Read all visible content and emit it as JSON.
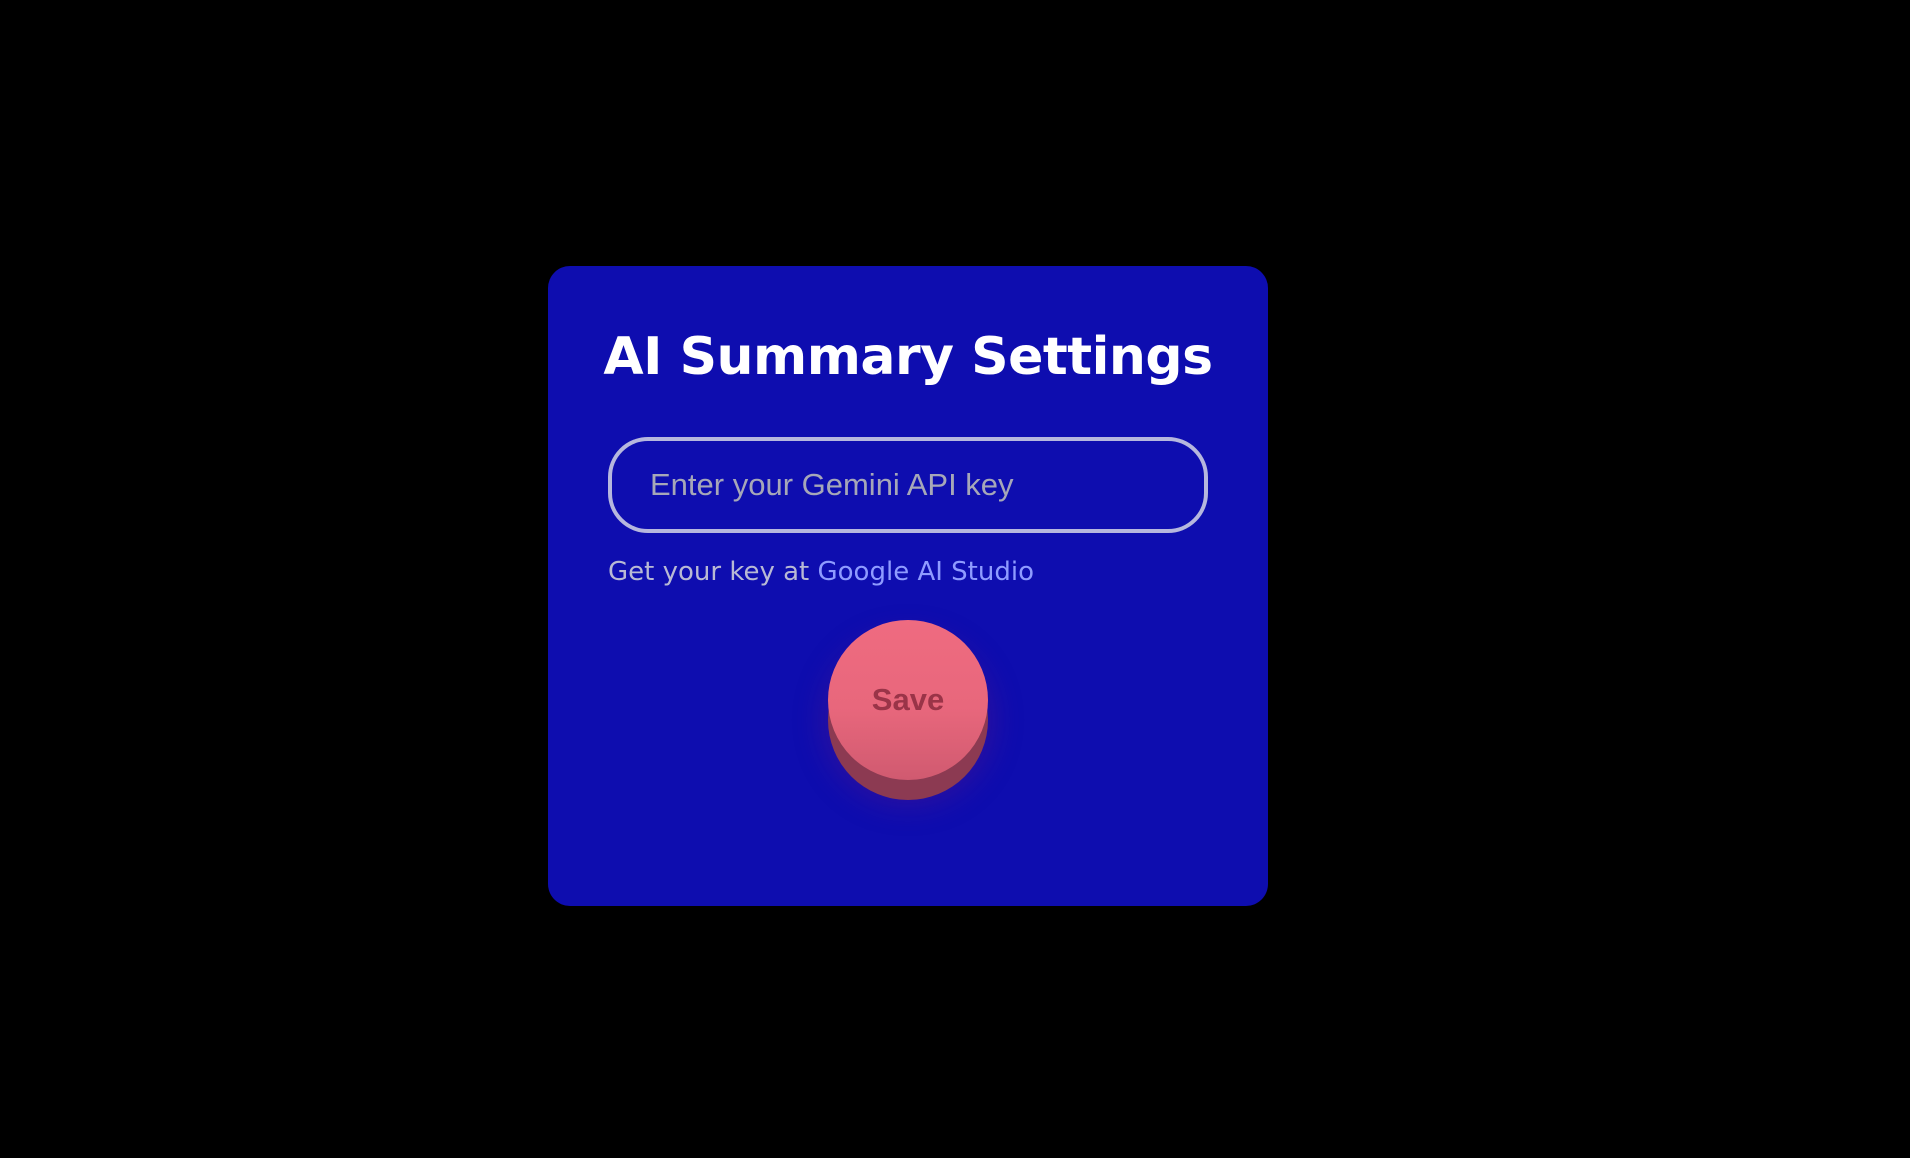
{
  "settings": {
    "title": "AI Summary Settings",
    "api_key_input": {
      "value": "",
      "placeholder": "Enter your Gemini API key"
    },
    "help_text": "Get your key at ",
    "help_link_label": "Google AI Studio",
    "save_label": "Save"
  },
  "colors": {
    "page_background": "#000000",
    "panel_background": "#0e0daf",
    "title_text": "#ffffff",
    "input_border": "#b6b7de",
    "placeholder_text": "#a6a7b8",
    "help_text": "#b8b9d4",
    "link": "#8f9bff",
    "save_button": "#ec6a7e",
    "save_button_shadow": "#8c3a52",
    "save_label": "#9a3448"
  }
}
